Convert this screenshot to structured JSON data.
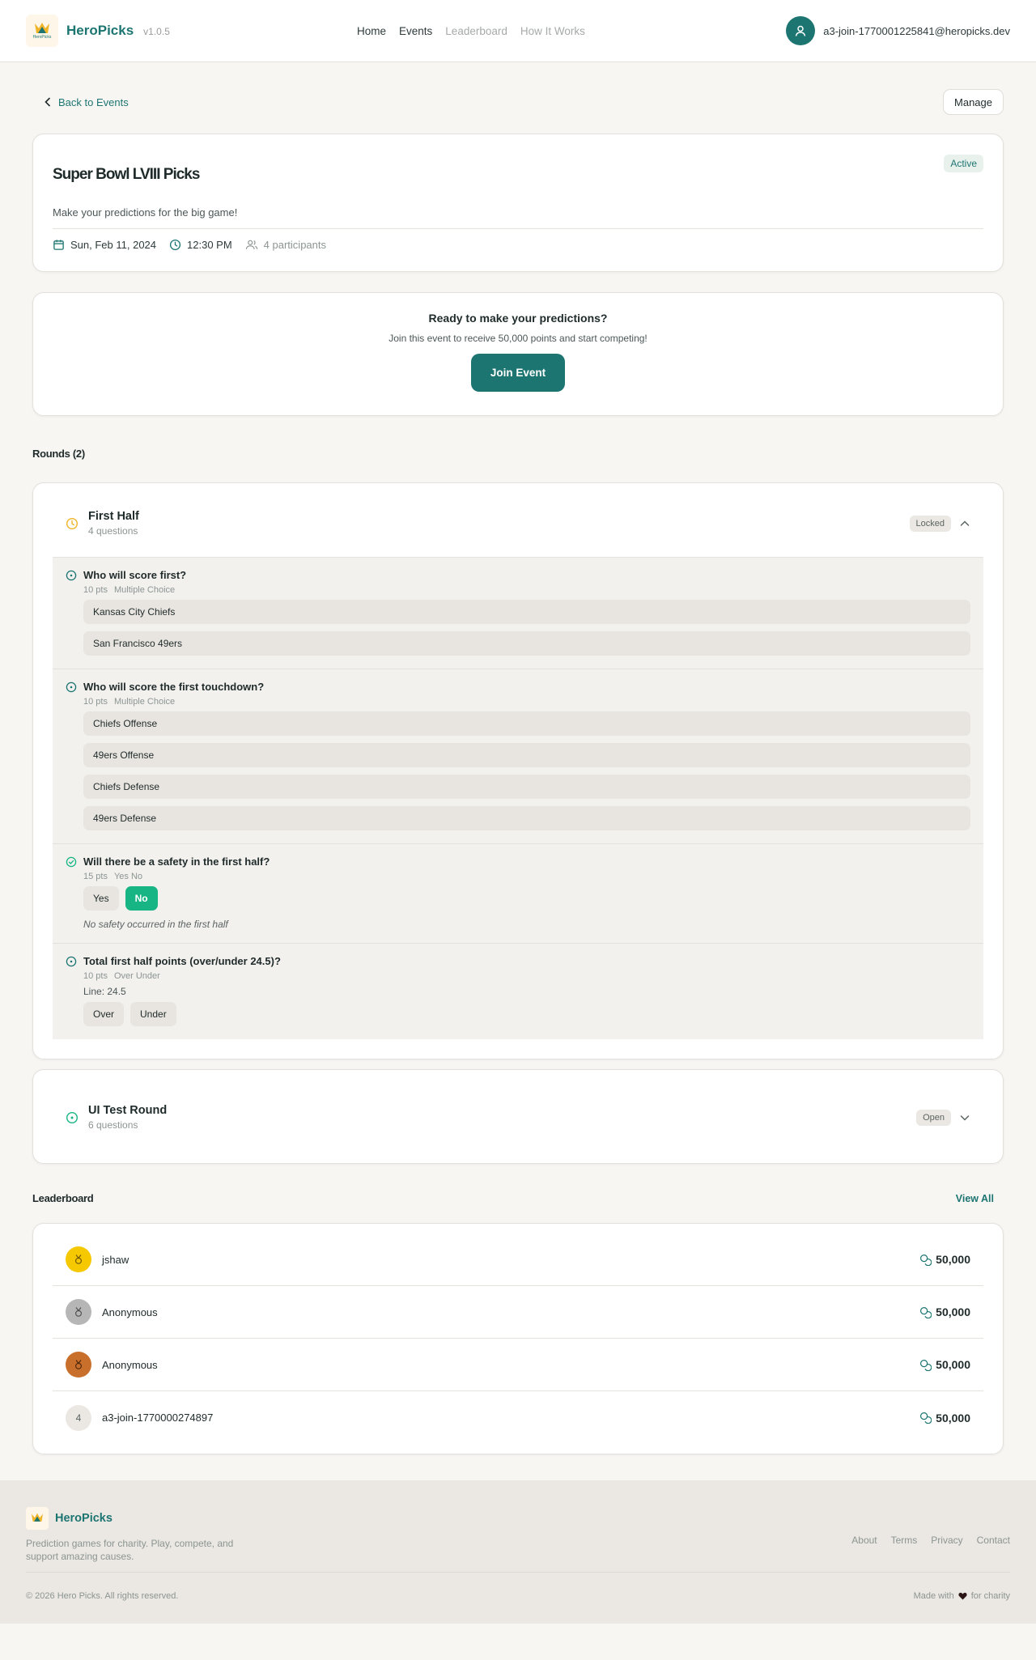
{
  "header": {
    "brand": "HeroPicks",
    "logo_text": "HeroPicks",
    "version": "v1.0.5",
    "nav": [
      "Home",
      "Events",
      "Leaderboard",
      "How It Works"
    ],
    "user_email": "a3-join-1770001225841@heropicks.dev"
  },
  "subhead": {
    "back_label": "Back to Events",
    "manage_label": "Manage"
  },
  "event": {
    "title": "Super Bowl LVIII Picks",
    "status": "Active",
    "description": "Make your predictions for the big game!",
    "date": "Sun, Feb 11, 2024",
    "time": "12:30 PM",
    "participants": "4 participants"
  },
  "join": {
    "title": "Ready to make your predictions?",
    "text": "Join this event to receive 50,000 points and start competing!",
    "button": "Join Event"
  },
  "rounds_title": "Rounds (2)",
  "rounds": [
    {
      "name": "First Half",
      "count": "4 questions",
      "status": "Locked",
      "questions": [
        {
          "text": "Who will score first?",
          "points": "10 pts",
          "type": "Multiple Choice",
          "options": [
            "Kansas City Chiefs",
            "San Francisco 49ers"
          ]
        },
        {
          "text": "Who will score the first touchdown?",
          "points": "10 pts",
          "type": "Multiple Choice",
          "options": [
            "Chiefs Offense",
            "49ers Offense",
            "Chiefs Defense",
            "49ers Defense"
          ]
        },
        {
          "text": "Will there be a safety in the first half?",
          "points": "15 pts",
          "type": "Yes No",
          "pills": [
            "Yes",
            "No"
          ],
          "note": "No safety occurred in the first half"
        },
        {
          "text": "Total first half points (over/under 24.5)?",
          "points": "10 pts",
          "type": "Over Under",
          "line": "Line: 24.5",
          "pills": [
            "Over",
            "Under"
          ]
        }
      ]
    },
    {
      "name": "UI Test Round",
      "count": "6 questions",
      "status": "Open"
    }
  ],
  "leaderboard": {
    "title": "Leaderboard",
    "view_all": "View All",
    "rows": [
      {
        "rank": "1",
        "name": "jshaw",
        "points": "50,000",
        "medal": "gold"
      },
      {
        "rank": "2",
        "name": "Anonymous",
        "points": "50,000",
        "medal": "silver"
      },
      {
        "rank": "3",
        "name": "Anonymous",
        "points": "50,000",
        "medal": "bronze"
      },
      {
        "rank": "4",
        "name": "a3-join-1770000274897",
        "points": "50,000",
        "medal": "none"
      }
    ]
  },
  "footer": {
    "brand": "HeroPicks",
    "tagline": "Prediction games for charity. Play, compete, and support amazing causes.",
    "links": [
      "About",
      "Terms",
      "Privacy",
      "Contact"
    ],
    "copyright": "© 2026 Hero Picks. All rights reserved.",
    "made_with": "Made with",
    "for_charity": "for charity"
  },
  "colors": {
    "brand": "#1d7572",
    "selected": "#17b584",
    "locked_icon": "#f0b429",
    "gold": "#f5c800",
    "silver": "#b6b6b6",
    "bronze": "#c96f2c"
  }
}
